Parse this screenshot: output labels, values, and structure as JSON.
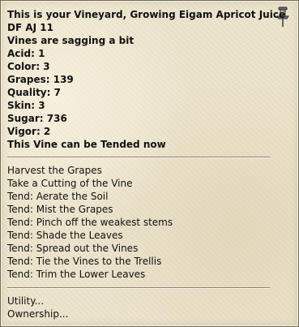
{
  "window": {
    "title": "This is your Vineyard, Growing Eigam Apricot Juice",
    "subtitle": "DF AJ  11",
    "status": "Vines are sagging a bit",
    "pin_icon": "pushpin-icon"
  },
  "stats": [
    {
      "label": "Acid",
      "value": "1",
      "text": "Acid: 1"
    },
    {
      "label": "Color",
      "value": "3",
      "text": "Color: 3"
    },
    {
      "label": "Grapes",
      "value": "139",
      "text": "Grapes: 139"
    },
    {
      "label": "Quality",
      "value": "7",
      "text": "Quality: 7"
    },
    {
      "label": "Skin",
      "value": "3",
      "text": "Skin: 3"
    },
    {
      "label": "Sugar",
      "value": "736",
      "text": "Sugar: 736"
    },
    {
      "label": "Vigor",
      "value": "2",
      "text": "Vigor: 2"
    }
  ],
  "tend_status": "This Vine can be Tended now",
  "actions": [
    "Harvest the Grapes",
    "Take a Cutting of the Vine",
    "Tend: Aerate the Soil",
    "Tend: Mist the Grapes",
    "Tend: Pinch off the weakest stems",
    "Tend: Shade the Leaves",
    "Tend: Spread out the Vines",
    "Tend: Tie the Vines to the Trellis",
    "Tend: Trim the Lower Leaves"
  ],
  "submenus": [
    "Utility...",
    "Ownership..."
  ]
}
